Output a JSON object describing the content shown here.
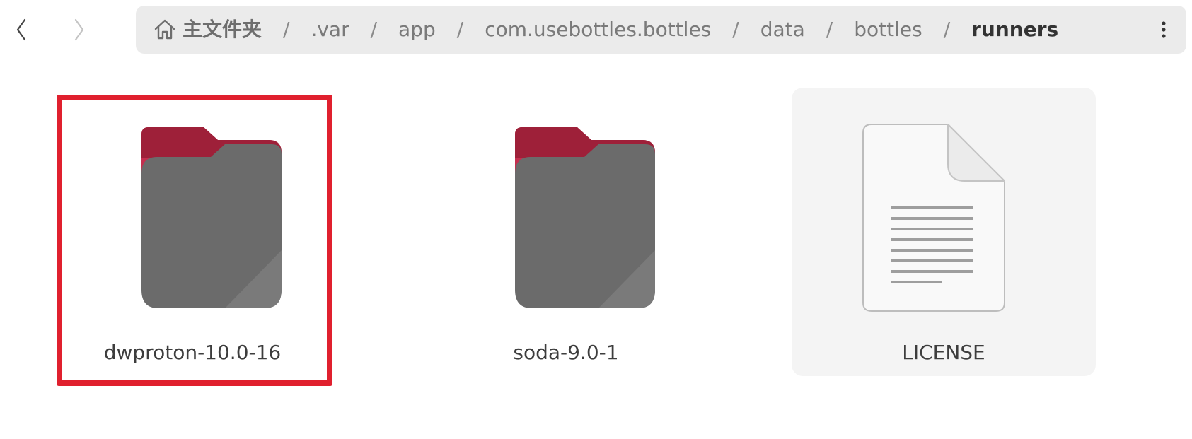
{
  "toolbar": {
    "back_icon": "chevron-left-icon",
    "forward_icon": "chevron-right-icon",
    "menu_icon": "vertical-ellipsis-icon"
  },
  "pathbar": {
    "home_icon": "home-icon",
    "separator": "/",
    "crumbs": [
      {
        "label": "主文件夹"
      },
      {
        "label": ".var"
      },
      {
        "label": "app"
      },
      {
        "label": "com.usebottles.bottles"
      },
      {
        "label": "data"
      },
      {
        "label": "bottles"
      },
      {
        "label": "runners"
      }
    ]
  },
  "files": [
    {
      "name": "dwproton-10.0-16",
      "type": "folder",
      "icon": "folder-icon",
      "highlighted": true
    },
    {
      "name": "soda-9.0-1",
      "type": "folder",
      "icon": "folder-icon"
    },
    {
      "name": "LICENSE",
      "type": "text-file",
      "icon": "text-file-icon",
      "hovered": true
    }
  ],
  "colors": {
    "folder_tab": "#c42f4f",
    "folder_body": "#6b6b6b",
    "highlight_border": "#e0202e",
    "pathbar_bg": "#ebebeb"
  }
}
